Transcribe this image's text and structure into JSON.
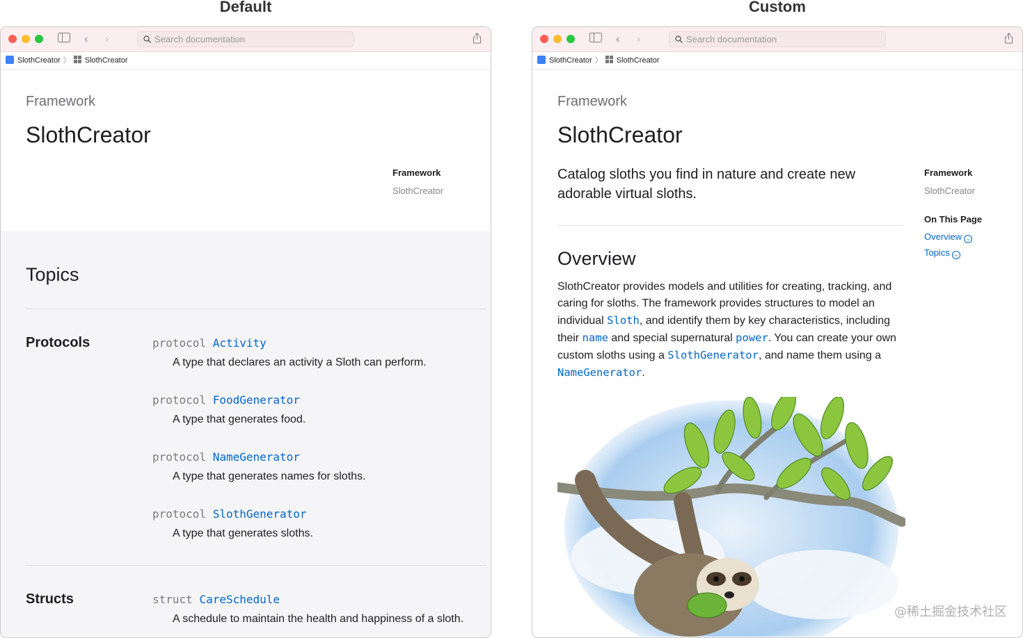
{
  "captions": {
    "left": "Default",
    "right": "Custom"
  },
  "window": {
    "search_placeholder": "Search documentation",
    "breadcrumb": [
      "SlothCreator",
      "SlothCreator"
    ],
    "icons": [
      "sidebar-toggle-icon",
      "back-icon",
      "forward-icon",
      "search-icon",
      "share-icon"
    ]
  },
  "left": {
    "eyebrow": "Framework",
    "title": "SlothCreator",
    "side_heading": "Framework",
    "side_value": "SlothCreator",
    "topics_title": "Topics",
    "protocols_heading": "Protocols",
    "protocols": [
      {
        "keyword": "protocol",
        "name": "Activity",
        "description": "A type that declares an activity a Sloth can perform."
      },
      {
        "keyword": "protocol",
        "name": "FoodGenerator",
        "description": "A type that generates food."
      },
      {
        "keyword": "protocol",
        "name": "NameGenerator",
        "description": "A type that generates names for sloths."
      },
      {
        "keyword": "protocol",
        "name": "SlothGenerator",
        "description": "A type that generates sloths."
      }
    ],
    "structs_heading": "Structs",
    "structs": [
      {
        "keyword": "struct",
        "name": "CareSchedule",
        "description": "A schedule to maintain the health and happiness of a sloth."
      }
    ]
  },
  "right": {
    "eyebrow": "Framework",
    "title": "SlothCreator",
    "abstract": "Catalog sloths you find in nature and create new adorable virtual sloths.",
    "abstract_lines": [
      "Catalog sloths you find in nature and create new",
      "adorable virtual sloths."
    ],
    "side_heading": "Framework",
    "side_value": "SlothCreator",
    "on_this_page": "On This Page",
    "otp_links": [
      "Overview",
      "Topics"
    ],
    "overview_title": "Overview",
    "overview": {
      "p1": "SlothCreator provides models and utilities for creating, tracking, and",
      "p2": "caring for sloths. The framework provides structures to model an",
      "p3a": "individual ",
      "c_sloth": "Sloth",
      "p3b": ", and identify them by key characteristics, including",
      "p4a": "their ",
      "c_name": "name",
      "p4b": " and special supernatural ",
      "c_power": "power",
      "p4c": ". You can create your own",
      "p5a": "custom sloths using a ",
      "c_slothgen": "SlothGenerator",
      "p5b": ", and name them using a",
      "c_namegen": "NameGenerator",
      "p6b": "."
    }
  },
  "watermark": "@稀土掘金技术社区"
}
